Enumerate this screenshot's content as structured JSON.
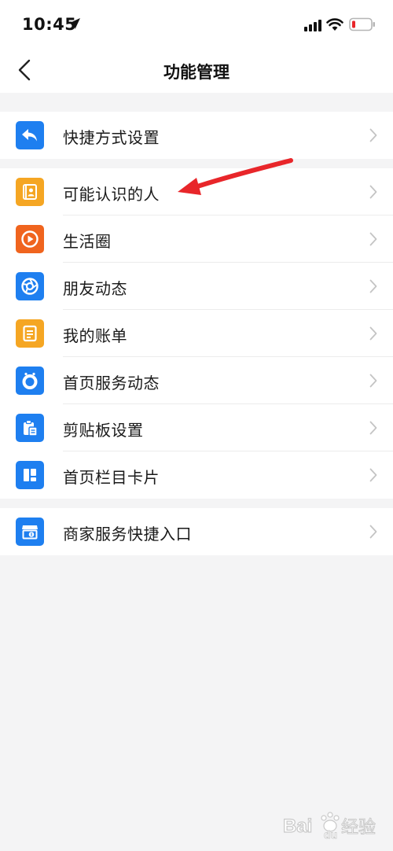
{
  "status_bar": {
    "time": "10:45"
  },
  "nav": {
    "title": "功能管理"
  },
  "groups": [
    {
      "items": [
        {
          "label": "快捷方式设置",
          "icon": "reply-icon",
          "color": "#1e7ff0"
        }
      ]
    },
    {
      "items": [
        {
          "label": "可能认识的人",
          "icon": "contacts-icon",
          "color": "#f5a623"
        },
        {
          "label": "生活圈",
          "icon": "play-circle-icon",
          "color": "#f0641e"
        },
        {
          "label": "朋友动态",
          "icon": "aperture-icon",
          "color": "#1e7ff0"
        },
        {
          "label": "我的账单",
          "icon": "bill-icon",
          "color": "#f5a623"
        },
        {
          "label": "首页服务动态",
          "icon": "donut-icon",
          "color": "#1e7ff0"
        },
        {
          "label": "剪贴板设置",
          "icon": "clipboard-icon",
          "color": "#1e7ff0"
        },
        {
          "label": "首页栏目卡片",
          "icon": "layout-icon",
          "color": "#1e7ff0"
        }
      ]
    },
    {
      "items": [
        {
          "label": "商家服务快捷入口",
          "icon": "store-icon",
          "color": "#1e7ff0"
        }
      ]
    }
  ],
  "annotation": {
    "arrow_color": "#e8262a"
  },
  "watermark": {
    "text": "Bai du 经验"
  }
}
